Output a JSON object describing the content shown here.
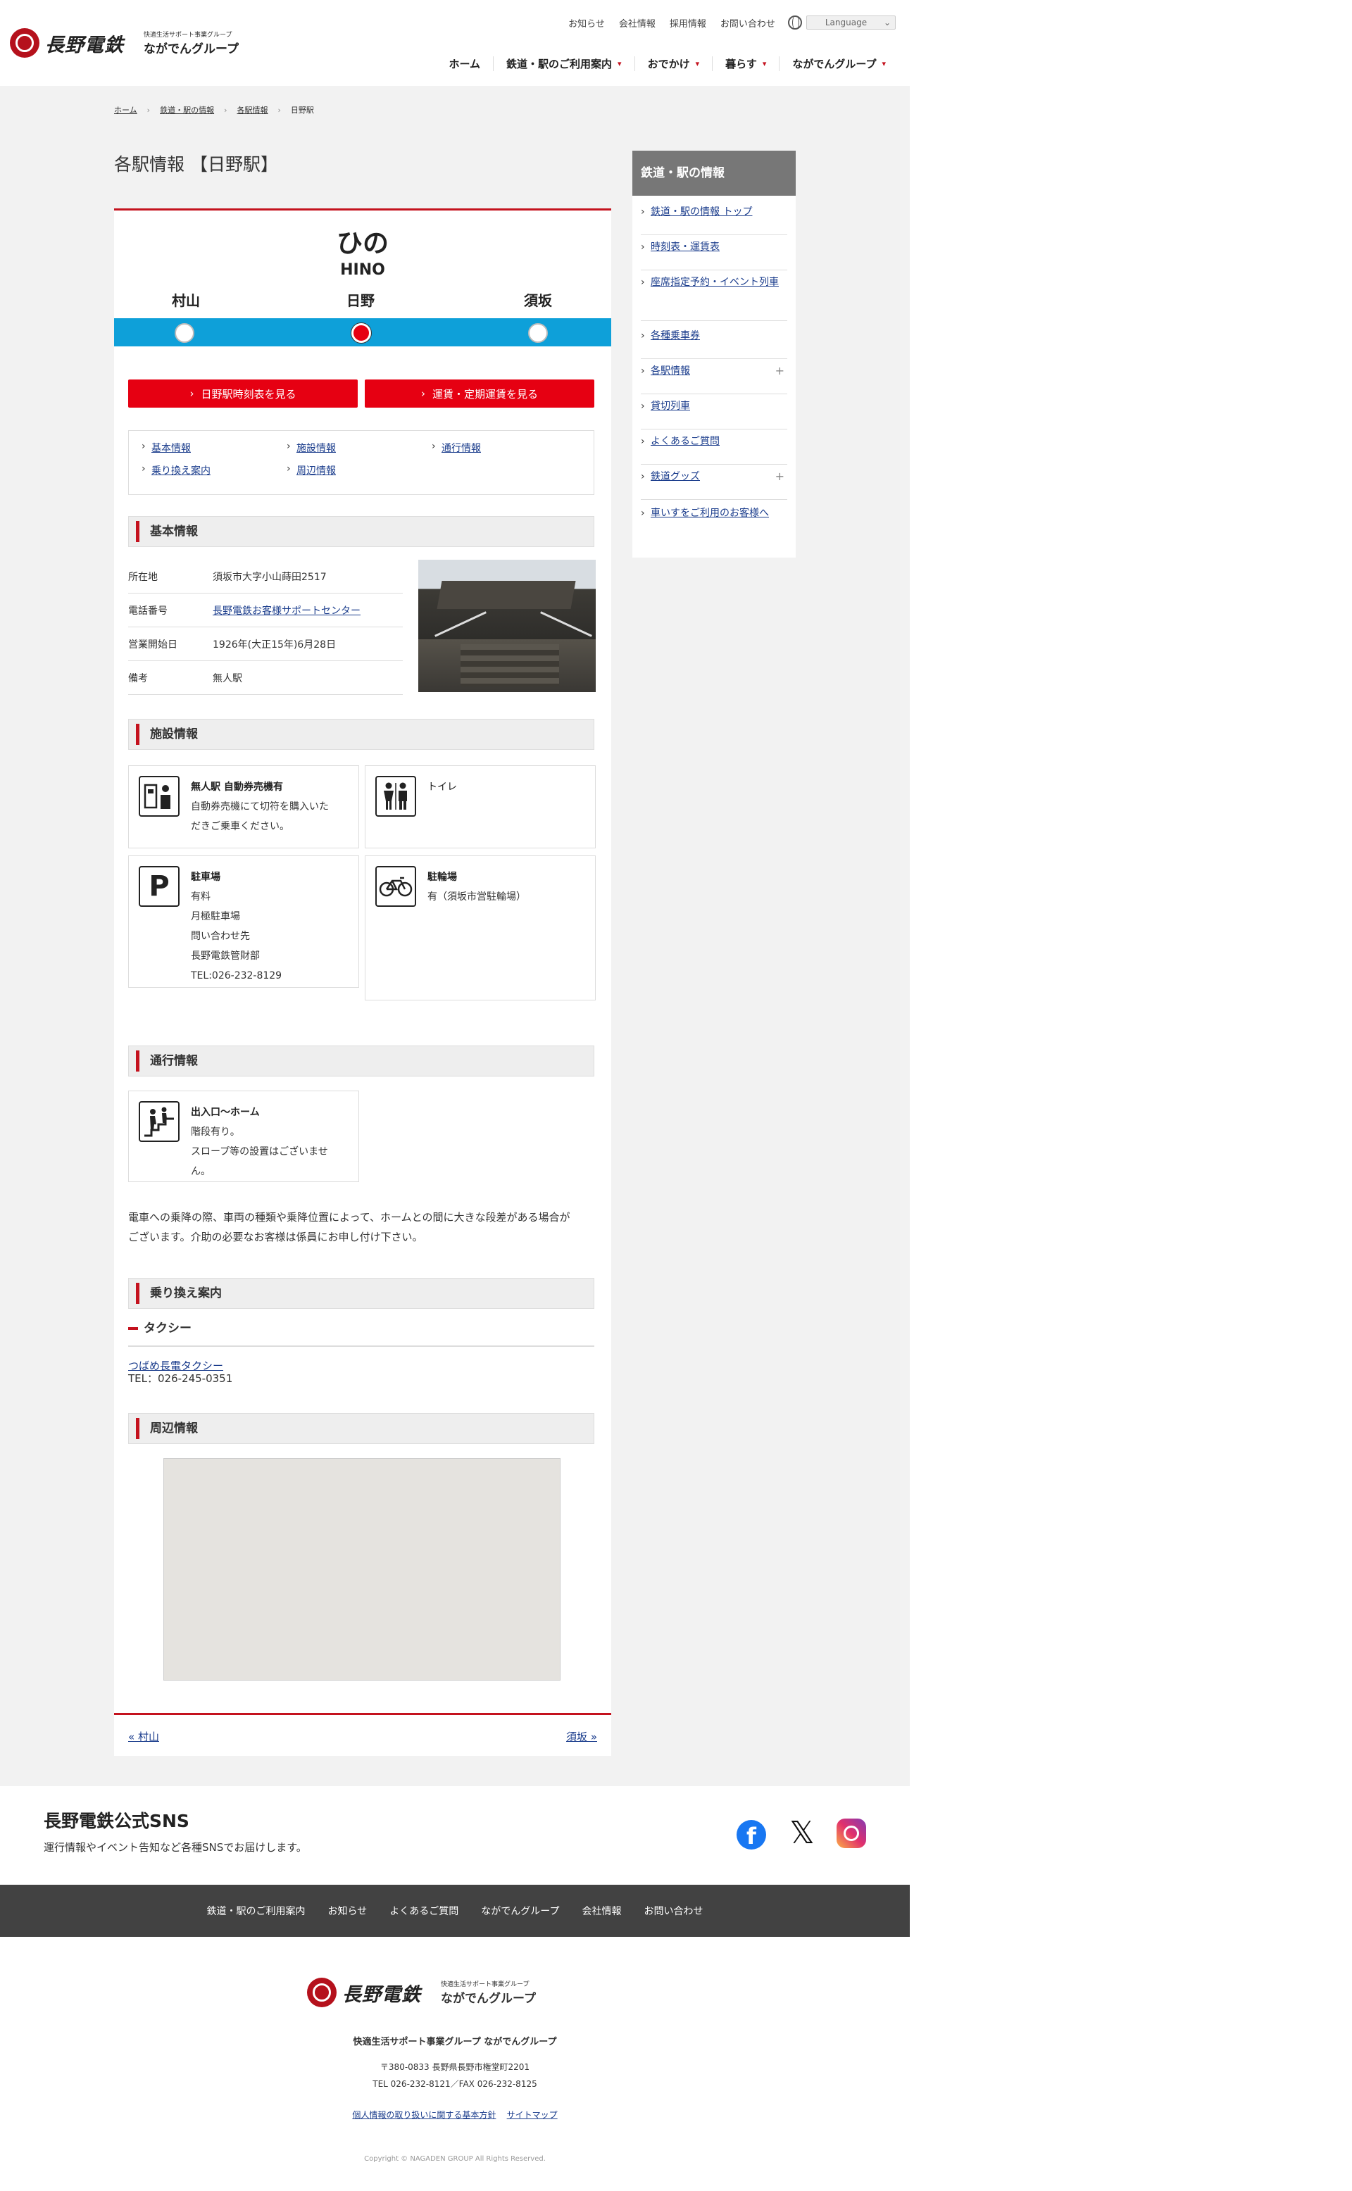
{
  "header": {
    "logo_text": "長野電鉄",
    "group_small": "快適生活サポート事業グループ",
    "group_name": "ながでんグループ",
    "util_links": [
      "お知らせ",
      "会社情報",
      "採用情報",
      "お問い合わせ"
    ],
    "language_label": "Language",
    "nav": [
      "ホーム",
      "鉄道・駅のご利用案内",
      "おでかけ",
      "暮らす",
      "ながでんグループ"
    ]
  },
  "breadcrumb": [
    "ホーム",
    "鉄道・駅の情報",
    "各駅情報",
    "日野駅"
  ],
  "page_title": "各駅情報 【日野駅】",
  "station": {
    "kana": "ひの",
    "romaji": "HINO",
    "prev": "村山",
    "current": "日野",
    "next": "須坂",
    "line_color": "#0ea0d9",
    "accent": "#e60012"
  },
  "buttons": {
    "timetable": "日野駅時刻表を見る",
    "fare": "運賃・定期運賃を見る"
  },
  "anchor_links": [
    "基本情報",
    "施設情報",
    "通行情報",
    "乗り換え案内",
    "周辺情報"
  ],
  "basic": {
    "heading": "基本情報",
    "rows": [
      {
        "k": "所在地",
        "v": "須坂市大字小山蒔田2517",
        "link": false
      },
      {
        "k": "電話番号",
        "v": "長野電鉄お客様サポートセンター",
        "link": true
      },
      {
        "k": "営業開始日",
        "v": "1926年(大正15年)6月28日",
        "link": false
      },
      {
        "k": "備考",
        "v": "無人駅",
        "link": false
      }
    ]
  },
  "facility": {
    "heading": "施設情報",
    "items": [
      {
        "icon": "ticket-machine-icon",
        "title": "無人駅 自動券売機有",
        "lines": [
          "自動券売機にて切符を購入いた",
          "だきご乗車ください。"
        ]
      },
      {
        "icon": "toilet-icon",
        "title": "トイレ",
        "lines": []
      },
      {
        "icon": "parking-icon",
        "glyph": "P",
        "title": "駐車場",
        "lines": [
          "有料",
          "月極駐車場",
          "問い合わせ先",
          "長野電鉄管財部",
          "TEL:026-232-8129"
        ]
      },
      {
        "icon": "bicycle-icon",
        "title": "駐輪場",
        "lines": [
          "有（須坂市営駐輪場）"
        ]
      }
    ]
  },
  "access": {
    "heading": "通行情報",
    "item": {
      "icon": "stairs-icon",
      "title": "出入口～ホーム",
      "lines": [
        "階段有り。",
        "スロープ等の設置はございませ",
        "ん。"
      ]
    },
    "note_lines": [
      "電車への乗降の際、車両の種類や乗降位置によって、ホームとの間に大きな段差がある場合が",
      "ございます。介助の必要なお客様は係員にお申し付け下さい。"
    ]
  },
  "transfer": {
    "heading": "乗り換え案内",
    "sub": "タクシー",
    "company": "つばめ長電タクシー",
    "tel": "TEL：026-245-0351"
  },
  "nearby": {
    "heading": "周辺情報"
  },
  "pager": {
    "prev": "« 村山",
    "next": "須坂 »"
  },
  "sidebar": {
    "heading": "鉄道・駅の情報",
    "items": [
      {
        "label": "鉄道・駅の情報 トップ",
        "plus": false
      },
      {
        "label": "時刻表・運賃表",
        "plus": false
      },
      {
        "label": "座席指定予約・イベント列車",
        "plus": false
      },
      {
        "label": "各種乗車券",
        "plus": false
      },
      {
        "label": "各駅情報",
        "plus": true
      },
      {
        "label": "貸切列車",
        "plus": false
      },
      {
        "label": "よくあるご質問",
        "plus": false
      },
      {
        "label": "鉄道グッズ",
        "plus": true
      },
      {
        "label": "車いすをご利用のお客様へ",
        "plus": false
      }
    ]
  },
  "sns": {
    "title": "長野電鉄公式SNS",
    "desc": "運行情報やイベント告知など各種SNSでお届けします。"
  },
  "footer_nav": [
    "鉄道・駅のご利用案内",
    "お知らせ",
    "よくあるご質問",
    "ながでんグループ",
    "会社情報",
    "お問い合わせ"
  ],
  "footer": {
    "group_line": "快適生活サポート事業グループ ながでんグループ",
    "address": "〒380-0833 長野県長野市権堂町2201",
    "tel": "TEL 026-232-8121／FAX 026-232-8125",
    "privacy": "個人情報の取り扱いに関する基本方針",
    "sitemap": "サイトマップ",
    "copyright": "Copyright © NAGADEN GROUP All Rights Reserved."
  }
}
